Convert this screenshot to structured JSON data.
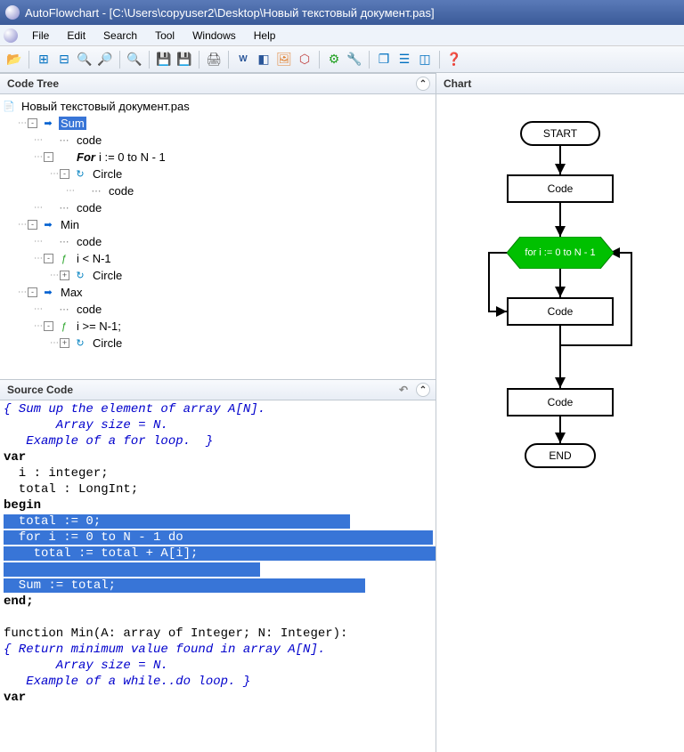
{
  "title": "AutoFlowchart - [C:\\Users\\copyuser2\\Desktop\\Новый текстовый документ.pas]",
  "menu": {
    "items": [
      "File",
      "Edit",
      "Search",
      "Tool",
      "Windows",
      "Help"
    ]
  },
  "panels": {
    "codeTree": "Code Tree",
    "sourceCode": "Source Code",
    "chart": "Chart"
  },
  "tree": [
    {
      "indent": 0,
      "toggle": "",
      "icon": "file",
      "label": "Новый текстовый документ.pas",
      "sel": false
    },
    {
      "indent": 1,
      "toggle": "-",
      "icon": "arrow",
      "label": "Sum",
      "sel": true
    },
    {
      "indent": 2,
      "toggle": "",
      "icon": "code",
      "label": "code",
      "sel": false
    },
    {
      "indent": 2,
      "toggle": "-",
      "icon": "for",
      "label": "i := 0 to N - 1",
      "sel": false,
      "bold": true,
      "prefix": "For"
    },
    {
      "indent": 3,
      "toggle": "-",
      "icon": "loop",
      "label": "Circle",
      "sel": false
    },
    {
      "indent": 4,
      "toggle": "",
      "icon": "code",
      "label": "code",
      "sel": false
    },
    {
      "indent": 2,
      "toggle": "",
      "icon": "code",
      "label": "code",
      "sel": false
    },
    {
      "indent": 1,
      "toggle": "-",
      "icon": "arrow",
      "label": "Min",
      "sel": false
    },
    {
      "indent": 2,
      "toggle": "",
      "icon": "code",
      "label": "code",
      "sel": false
    },
    {
      "indent": 2,
      "toggle": "-",
      "icon": "func",
      "label": "i < N-1",
      "sel": false
    },
    {
      "indent": 3,
      "toggle": "+",
      "icon": "loop",
      "label": "Circle",
      "sel": false
    },
    {
      "indent": 1,
      "toggle": "-",
      "icon": "arrow",
      "label": "Max",
      "sel": false
    },
    {
      "indent": 2,
      "toggle": "",
      "icon": "code",
      "label": "code",
      "sel": false
    },
    {
      "indent": 2,
      "toggle": "-",
      "icon": "func",
      "label": "i >= N-1;",
      "sel": false
    },
    {
      "indent": 3,
      "toggle": "+",
      "icon": "loop",
      "label": "Circle",
      "sel": false
    }
  ],
  "source": {
    "lines": [
      {
        "t": "{ Sum up the element of array A[N].",
        "cls": "comment"
      },
      {
        "t": "       Array size = N.",
        "cls": "comment"
      },
      {
        "t": "   Example of a for loop.  }",
        "cls": "comment"
      },
      {
        "t": "var",
        "cls": "keyword"
      },
      {
        "t": "  i : integer;",
        "cls": ""
      },
      {
        "t": "  total : LongInt;",
        "cls": ""
      },
      {
        "t": "begin",
        "cls": "keyword"
      },
      {
        "t": "  total := 0;",
        "cls": "sel"
      },
      {
        "t": "  for i := 0 to N - 1 do",
        "cls": "sel"
      },
      {
        "t": "    total := total + A[i];",
        "cls": "sel"
      },
      {
        "t": "",
        "cls": "sel"
      },
      {
        "t": "  Sum := total;",
        "cls": "sel"
      },
      {
        "t": "end;",
        "cls": "keyword"
      },
      {
        "t": "",
        "cls": ""
      },
      {
        "t": "function Min(A: array of Integer; N: Integer):",
        "cls": ""
      },
      {
        "t": "{ Return minimum value found in array A[N].",
        "cls": "comment"
      },
      {
        "t": "       Array size = N.",
        "cls": "comment"
      },
      {
        "t": "   Example of a while..do loop. }",
        "cls": "comment"
      },
      {
        "t": "var",
        "cls": "keyword"
      }
    ]
  },
  "chart": {
    "start": "START",
    "code1": "Code",
    "decision": "for i := 0 to N - 1",
    "code2": "Code",
    "code3": "Code",
    "end": "END"
  }
}
